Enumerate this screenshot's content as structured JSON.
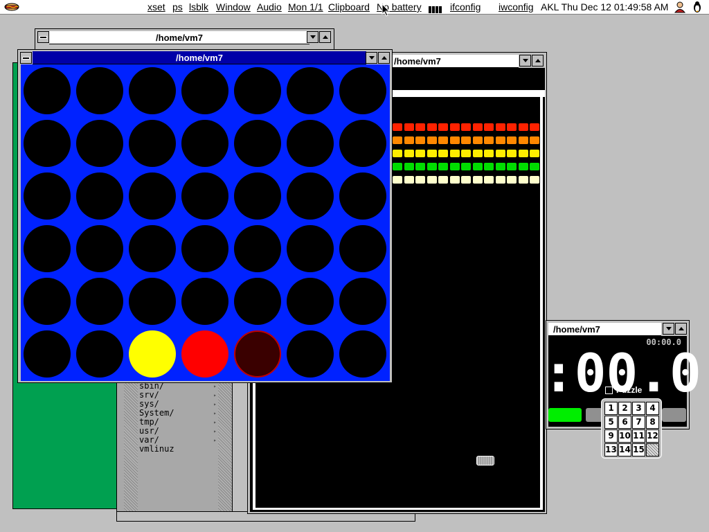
{
  "menubar": {
    "items": [
      "xset",
      "ps",
      "lsblk",
      "Window",
      "Audio",
      "Mon 1/1",
      "Clipboard",
      "No battery",
      "ifconfig",
      "iwconfig",
      "AKL Thu Dec 12 01:49:58 AM"
    ]
  },
  "windows": {
    "files_back": {
      "title": "/home/vm7"
    },
    "breakout": {
      "title": "/home/vm7"
    },
    "connect_four": {
      "title": "/home/vm7"
    },
    "timer": {
      "title": "/home/vm7",
      "small_time": "00:00.0",
      "big_time": ":00.0"
    },
    "puzzle": {
      "title": "Puzzle",
      "tiles": [
        "1",
        "2",
        "3",
        "4",
        "5",
        "6",
        "7",
        "8",
        "9",
        "10",
        "11",
        "12",
        "13",
        "14",
        "15",
        ""
      ]
    }
  },
  "filelist": {
    "entries": [
      {
        "name": "sbin/",
        "has_arrow": true
      },
      {
        "name": "srv/",
        "has_arrow": true
      },
      {
        "name": "sys/",
        "has_arrow": true
      },
      {
        "name": "System/",
        "has_arrow": true
      },
      {
        "name": "tmp/",
        "has_arrow": true
      },
      {
        "name": "usr/",
        "has_arrow": true
      },
      {
        "name": "var/",
        "has_arrow": true
      },
      {
        "name": "vmlinuz",
        "has_arrow": false
      }
    ]
  },
  "connect_four": {
    "rows": 6,
    "cols": 7,
    "pieces": [
      {
        "row": 5,
        "col": 2,
        "color": "yellow"
      },
      {
        "row": 5,
        "col": 3,
        "color": "red"
      },
      {
        "row": 5,
        "col": 4,
        "color": "dark"
      }
    ],
    "board_color": "#0022ff"
  },
  "breakout": {
    "brick_rows": [
      {
        "color": "#ff2200"
      },
      {
        "color": "#ff8800"
      },
      {
        "color": "#ffee00"
      },
      {
        "color": "#00dd00"
      },
      {
        "color": "#ffffcc"
      }
    ],
    "bricks_per_row": 13
  },
  "colors": {
    "desktop": "#c0c0c0",
    "active_title": "#0000a8",
    "green_panel": "#00a050"
  }
}
